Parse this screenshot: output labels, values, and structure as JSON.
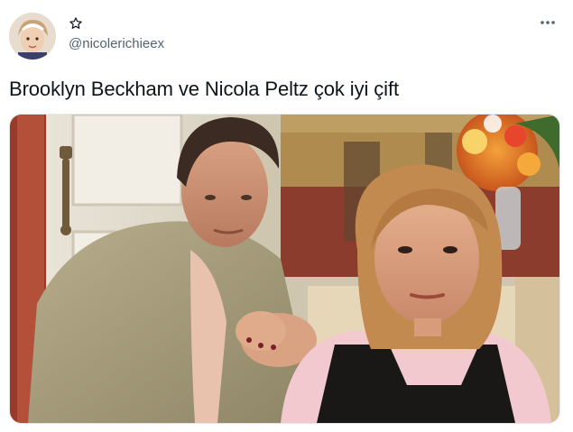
{
  "user": {
    "handle": "@nicolerichieex",
    "display_name_icon": "star-outline-icon"
  },
  "more_icon": "more-horizontal-icon",
  "tweet": {
    "text": "Brooklyn Beckham ve Nicola Peltz çok iyi çift"
  },
  "colors": {
    "text_primary": "#0f1419",
    "text_secondary": "#536471"
  }
}
